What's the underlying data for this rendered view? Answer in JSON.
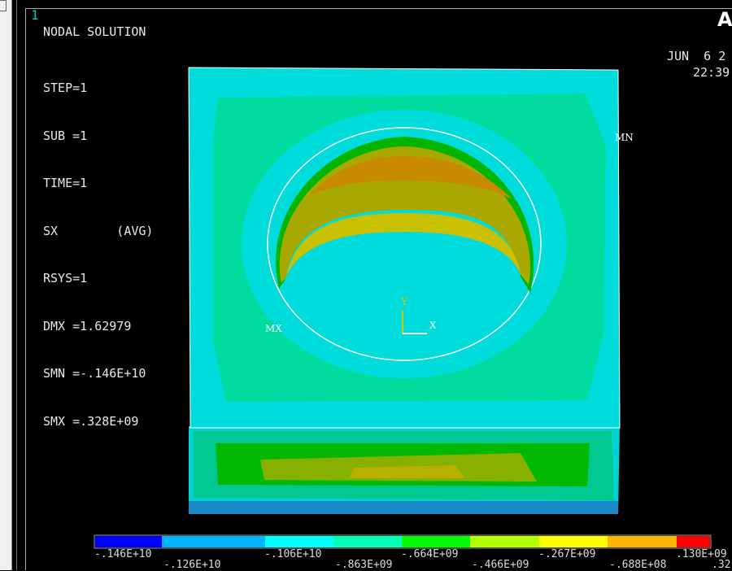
{
  "window_number": "1",
  "logo": "AN",
  "info": {
    "title": "NODAL SOLUTION",
    "lines": [
      "STEP=1",
      "SUB =1",
      "TIME=1",
      "SX        (AVG)",
      "RSYS=1",
      "DMX =1.62979",
      "SMN =-.146E+10",
      "SMX =.328E+09"
    ]
  },
  "date": "JUN  6 2",
  "time": "22:39",
  "labels": {
    "min": "MN",
    "max": "MX",
    "axis_x": "X",
    "axis_y": "Y"
  },
  "legend": {
    "colors": [
      "#0000ff",
      "#00b4ff",
      "#00ffff",
      "#00ffb4",
      "#00ff00",
      "#b4ff00",
      "#ffff00",
      "#ffb400",
      "#ff0000"
    ],
    "ticks_upper": [
      "-.146E+10",
      "-.106E+10",
      "-.664E+09",
      "-.267E+09",
      ".130E+09"
    ],
    "ticks_lower": [
      "-.126E+10",
      "-.863E+09",
      "-.466E+09",
      "-.688E+08",
      ".32"
    ]
  }
}
